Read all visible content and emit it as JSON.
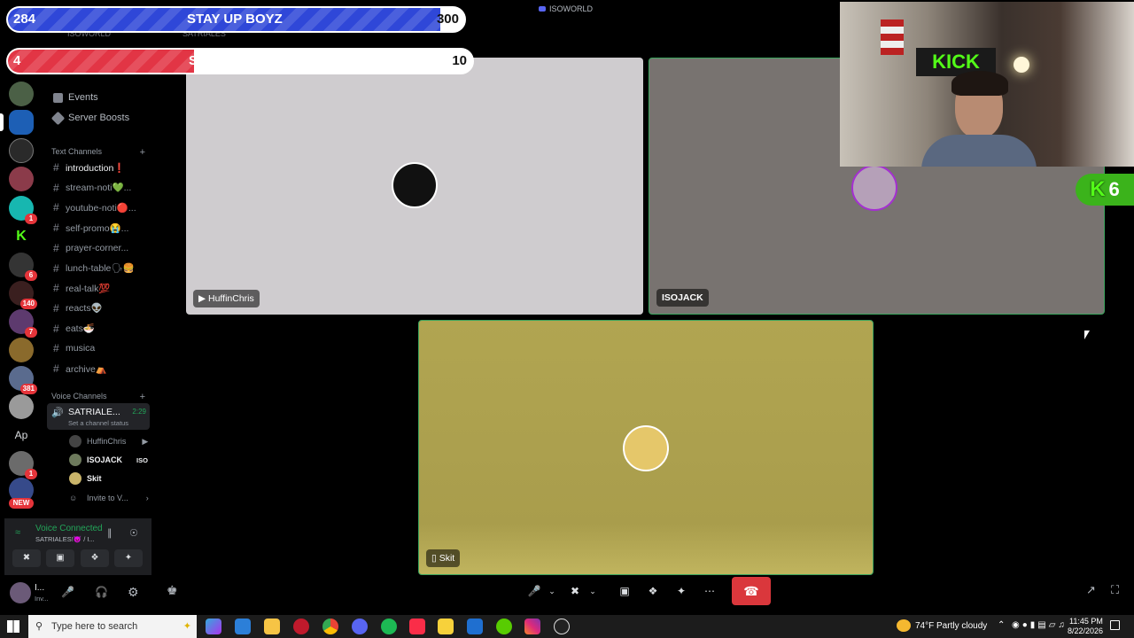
{
  "window": {
    "title": "ISOWORLD"
  },
  "overlays": {
    "goal1": {
      "current": "284",
      "title": "STAY UP BOYZ",
      "target": "300",
      "progress": 0.947,
      "color": "#2f47d8"
    },
    "goal2": {
      "current": "4",
      "title": "SUBSCRIBERS",
      "target": "10",
      "progress": 0.4,
      "color": "#e23545"
    },
    "kick_badge": {
      "letter": "K",
      "count": "6"
    }
  },
  "server_rail": {
    "badges": [
      "1",
      "6",
      "140",
      "7",
      "381",
      "1",
      "NEW"
    ],
    "text_server": "Ap"
  },
  "sidebar_top": {
    "server_name": "ISOWORLD",
    "voice_channel_title": "SATRIALES"
  },
  "channels": {
    "top_items": [
      "Events",
      "Server Boosts"
    ],
    "text_category": "Text Channels",
    "text_channels": [
      {
        "name": "introduction❗",
        "bold": true
      },
      {
        "name": "stream-noti💚...",
        "bold": false
      },
      {
        "name": "youtube-noti🔴...",
        "bold": false
      },
      {
        "name": "self-promo😭...",
        "bold": false
      },
      {
        "name": "prayer-corner...",
        "bold": false
      },
      {
        "name": "lunch-table🗣🍔",
        "bold": false
      },
      {
        "name": "real-talk💯",
        "bold": false
      },
      {
        "name": "reacts👽",
        "bold": false
      },
      {
        "name": "eats🍜",
        "bold": false
      },
      {
        "name": "musica",
        "bold": false
      },
      {
        "name": "archive⛺",
        "bold": false
      }
    ],
    "voice_category": "Voice Channels",
    "voice_channel": {
      "name": "SATRIALE...",
      "time": "2:29",
      "status": "Set a channel status"
    },
    "members": [
      {
        "name": "HuffinChris",
        "bold": false
      },
      {
        "name": "ISOJACK",
        "tag": "ISO",
        "bold": true
      },
      {
        "name": "Skit",
        "bold": true
      }
    ],
    "invite": "Invite to V..."
  },
  "voice_panel": {
    "title": "Voice Connected",
    "subtitle": "SATRIALES!👿 / I..."
  },
  "user_bar": {
    "name": "I...",
    "status": "Inv..."
  },
  "tiles": [
    {
      "name": "HuffinChris",
      "bg": "#cfcccf"
    },
    {
      "name": "ISOJACK",
      "bg": "#787370"
    },
    {
      "name": "Skit",
      "bg": "#ada24f"
    }
  ],
  "taskbar": {
    "search_placeholder": "Type here to search",
    "weather": "74°F  Partly cloudy",
    "time": "11:45 PM",
    "date": "8/22/2026"
  }
}
